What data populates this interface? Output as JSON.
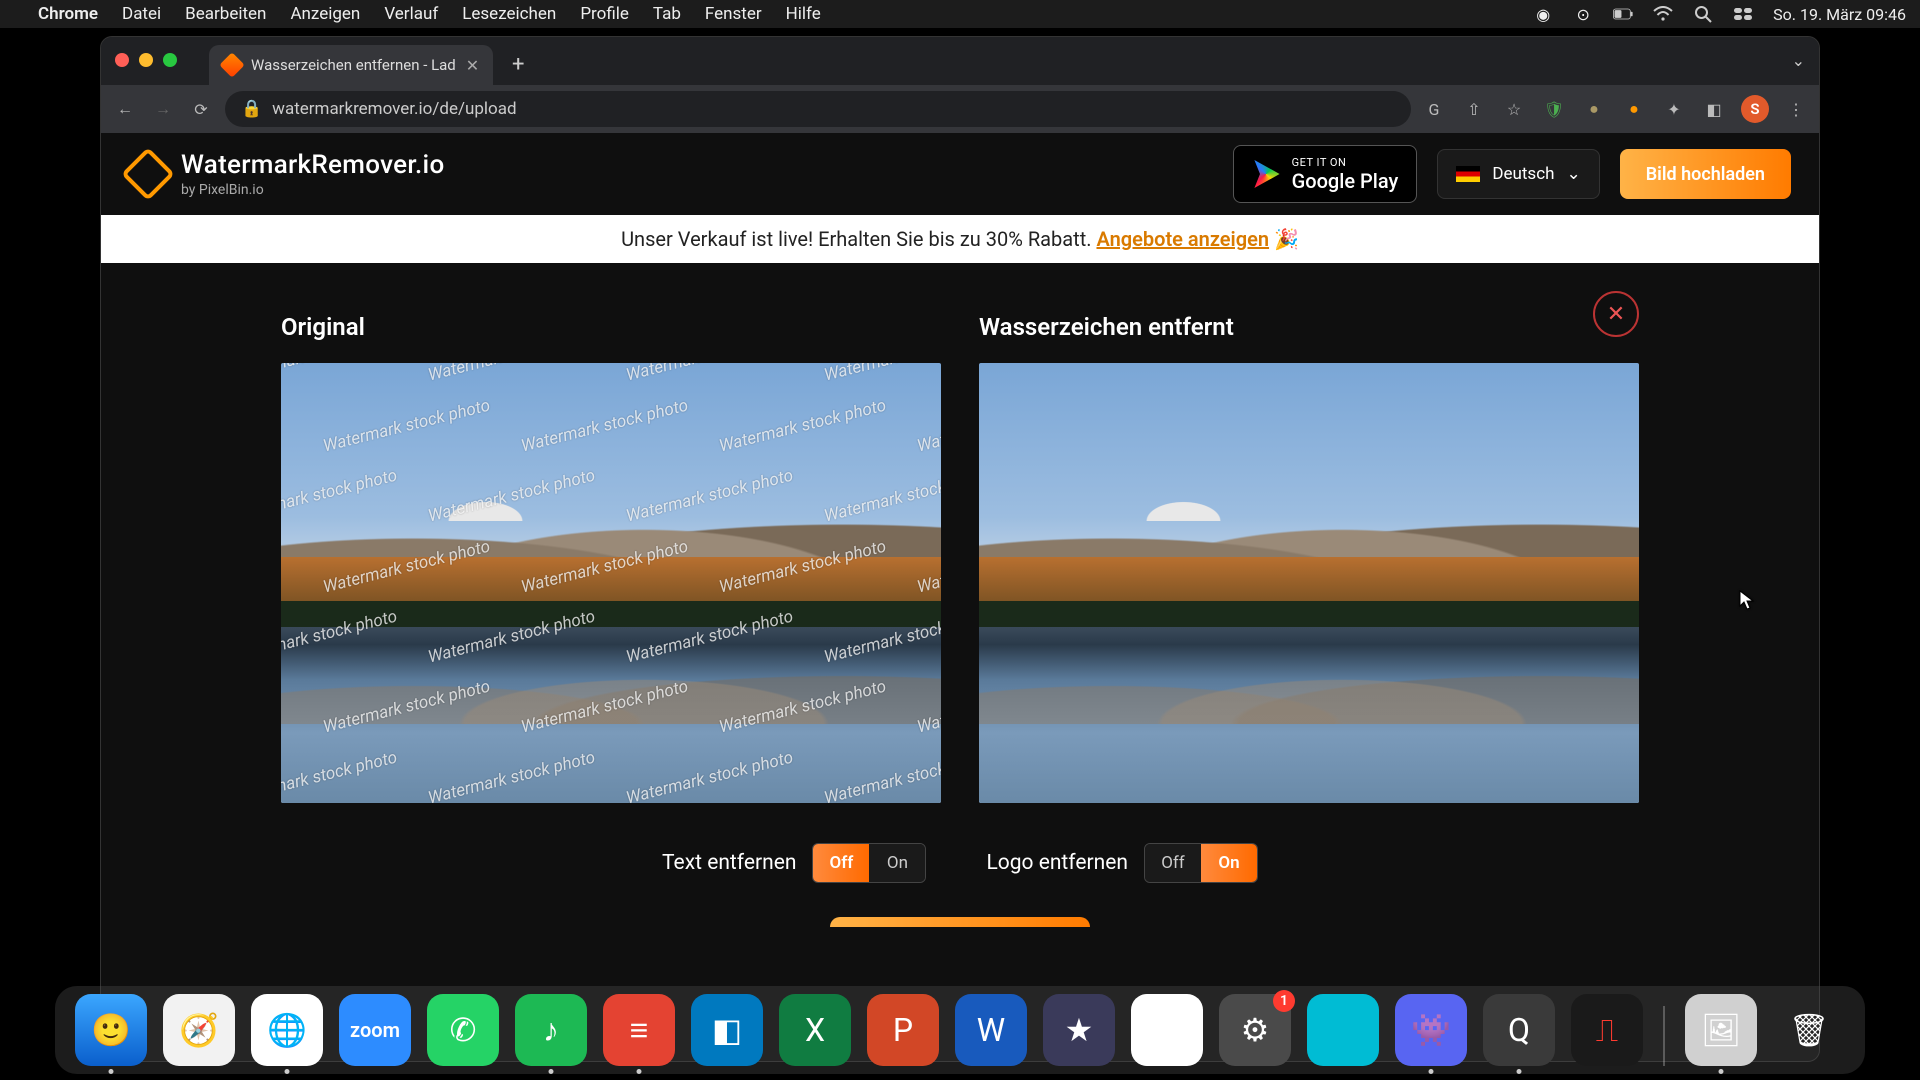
{
  "menubar": {
    "app": "Chrome",
    "items": [
      "Datei",
      "Bearbeiten",
      "Anzeigen",
      "Verlauf",
      "Lesezeichen",
      "Profile",
      "Tab",
      "Fenster",
      "Hilfe"
    ],
    "clock": "So. 19. März  09:46"
  },
  "browser": {
    "tab_title": "Wasserzeichen entfernen - Lad",
    "url": "watermarkremover.io/de/upload",
    "avatar_letter": "S"
  },
  "site": {
    "brand": "WatermarkRemover.io",
    "byline": "by PixelBin.io",
    "gplay_small": "GET IT ON",
    "gplay_big": "Google Play",
    "language": "Deutsch",
    "upload": "Bild hochladen"
  },
  "promo": {
    "text_a": "Unser Verkauf ist live! Erhalten Sie bis zu 30% Rabatt. ",
    "link": "Angebote anzeigen",
    "emoji": " 🎉"
  },
  "compare": {
    "left_title": "Original",
    "right_title": "Wasserzeichen entfernt",
    "watermark_text": "Watermark stock photo"
  },
  "controls": {
    "text_label": "Text entfernen",
    "logo_label": "Logo entfernen",
    "off": "Off",
    "on": "On",
    "text_state": "Off",
    "logo_state": "On"
  },
  "dock": {
    "settings_badge": "1"
  }
}
